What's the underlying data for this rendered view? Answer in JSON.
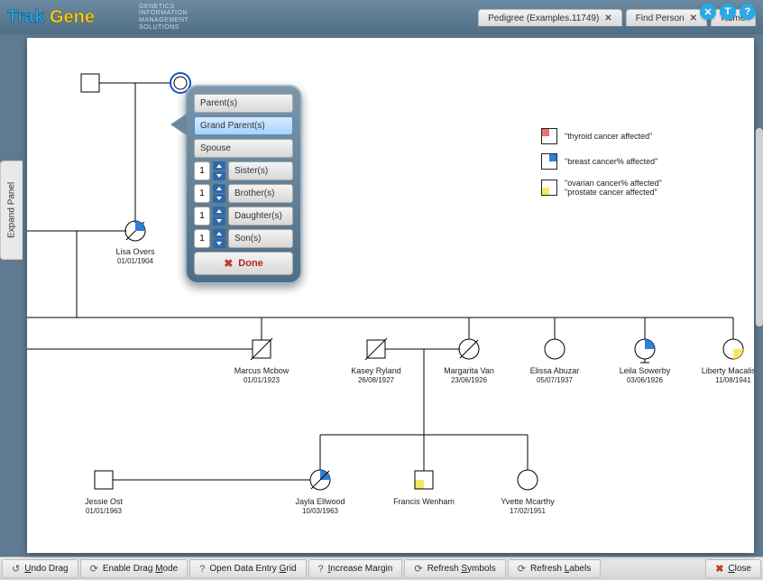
{
  "logo": {
    "text_a": "Trak",
    "text_b": "Gene",
    "tagline": "GENETICS\nINFORMATION\nMANAGEMENT\nSOLUTIONS"
  },
  "header": {
    "icons": {
      "close": "✕",
      "text": "T",
      "help": "?"
    },
    "tabs": [
      {
        "label": "Pedigree (Examples.11749)",
        "closable": true
      },
      {
        "label": "Find Person",
        "closable": true
      },
      {
        "label": "Home",
        "closable": false
      }
    ]
  },
  "expand_panel_label": "Expand Panel",
  "popup": {
    "options": [
      {
        "label": "Parent(s)",
        "count": null,
        "selected": false
      },
      {
        "label": "Grand Parent(s)",
        "count": null,
        "selected": true
      },
      {
        "label": "Spouse",
        "count": null,
        "selected": false
      },
      {
        "label": "Sister(s)",
        "count": "1",
        "selected": false
      },
      {
        "label": "Brother(s)",
        "count": "1",
        "selected": false
      },
      {
        "label": "Daughter(s)",
        "count": "1",
        "selected": false
      },
      {
        "label": "Son(s)",
        "count": "1",
        "selected": false
      }
    ],
    "done_label": "Done"
  },
  "legend": [
    {
      "label": "\"thyroid cancer affected\"",
      "tl": "#e8736b"
    },
    {
      "label": "\"breast cancer% affected\"",
      "tr": "#2f7ed8"
    },
    {
      "label_a": "\"ovarian cancer% affected\"",
      "label_b": "\"prostate cancer affected\"",
      "bl": "#f5e960"
    }
  ],
  "people": {
    "lisa": {
      "name": "Lisa Overs",
      "date": "01/01/1904"
    },
    "marcus": {
      "name": "Marcus Mcbow",
      "date": "01/01/1923"
    },
    "kasey": {
      "name": "Kasey Ryland",
      "date": "26/08/1927"
    },
    "margarita": {
      "name": "Margarita Van",
      "date": "23/06/1926"
    },
    "elissa": {
      "name": "Elissa Abuzar",
      "date": "05/07/1937"
    },
    "leila": {
      "name": "Leila Sowerby",
      "date": "03/06/1926"
    },
    "liberty": {
      "name": "Liberty Macalister",
      "date": "11/08/1941"
    },
    "jessie": {
      "name": "Jessie Ost",
      "date": "01/01/1963"
    },
    "jayla": {
      "name": "Jayla Ellwood",
      "date": "10/03/1963"
    },
    "francis": {
      "name": "Francis Wenham",
      "date": ""
    },
    "yvette": {
      "name": "Yvette Mcarthy",
      "date": "17/02/1951"
    }
  },
  "toolbar": [
    {
      "icon": "undo",
      "label_pre": "",
      "key": "U",
      "label_post": "ndo Drag"
    },
    {
      "icon": "refresh",
      "label_pre": "Enable Drag ",
      "key": "M",
      "label_post": "ode"
    },
    {
      "icon": "help",
      "label_pre": "Open Data Entry ",
      "key": "G",
      "label_post": "rid"
    },
    {
      "icon": "help",
      "label_pre": "",
      "key": "I",
      "label_post": "ncrease Margin"
    },
    {
      "icon": "refresh",
      "label_pre": "Refresh ",
      "key": "S",
      "label_post": "ymbols"
    },
    {
      "icon": "refresh",
      "label_pre": "Refresh ",
      "key": "L",
      "label_post": "abels"
    },
    {
      "icon": "close",
      "label_pre": "",
      "key": "C",
      "label_post": "lose"
    }
  ]
}
